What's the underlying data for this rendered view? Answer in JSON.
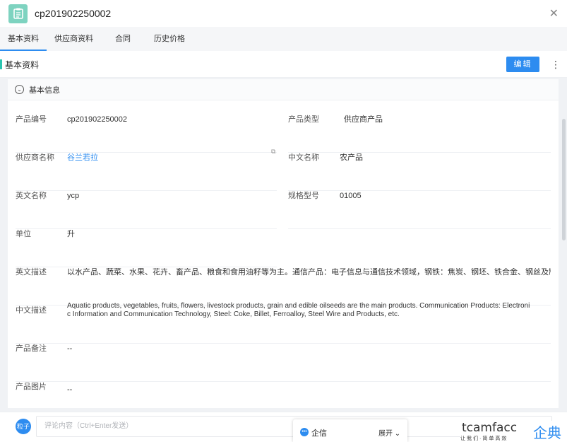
{
  "header": {
    "title": "cp201902250002",
    "close_icon": "close-icon",
    "doc_icon": "clipboard-icon"
  },
  "tabs": [
    {
      "label": "基本资料",
      "active": true
    },
    {
      "label": "供应商资料",
      "active": false
    },
    {
      "label": "合同",
      "active": false
    },
    {
      "label": "历史价格",
      "active": false
    }
  ],
  "section": {
    "title": "基本资料",
    "edit_label": "编辑",
    "more_icon": "more-vertical-icon"
  },
  "group": {
    "title": "基本信息"
  },
  "fields": {
    "product_no": {
      "label": "产品编号",
      "value": "cp201902250002"
    },
    "product_type": {
      "label": "产品类型",
      "value": "供应商产品"
    },
    "supplier": {
      "label": "供应商名称",
      "value": "谷兰若拉"
    },
    "cn_name": {
      "label": "中文名称",
      "value": "农产品"
    },
    "en_name": {
      "label": "英文名称",
      "value": "ycp"
    },
    "spec": {
      "label": "规格型号",
      "value": "01005"
    },
    "unit": {
      "label": "单位",
      "value": "升"
    },
    "en_desc": {
      "label": "英文描述",
      "value": "以水产品、蔬菜、水果、花卉、畜产品、粮食和食用油籽等为主。通信产品：电子信息与通信技术领域，钢铁：焦炭、钢坯、铁合金、钢丝及制品等。"
    },
    "cn_desc": {
      "label": "中文描述",
      "value_line1": "Aquatic products, vegetables, fruits, flowers, livestock products, grain and edible oilseeds are the main products. Communication Products: Electroni",
      "value_line2": "c Information and Communication Technology, Steel: Coke, Billet, Ferroalloy, Steel Wire and Products, etc."
    },
    "remark": {
      "label": "产品备注",
      "value": "--"
    },
    "image": {
      "label": "产品图片",
      "value": "--"
    }
  },
  "comment": {
    "avatar_text": "粒子",
    "placeholder": "评论内容（Ctrl+Enter发送）"
  },
  "qixin": {
    "name": "企信",
    "expand_label": "展开"
  },
  "watermark": {
    "brand": "tcamfacc",
    "cn": "企典",
    "tagline": "让我们·简单高效"
  }
}
